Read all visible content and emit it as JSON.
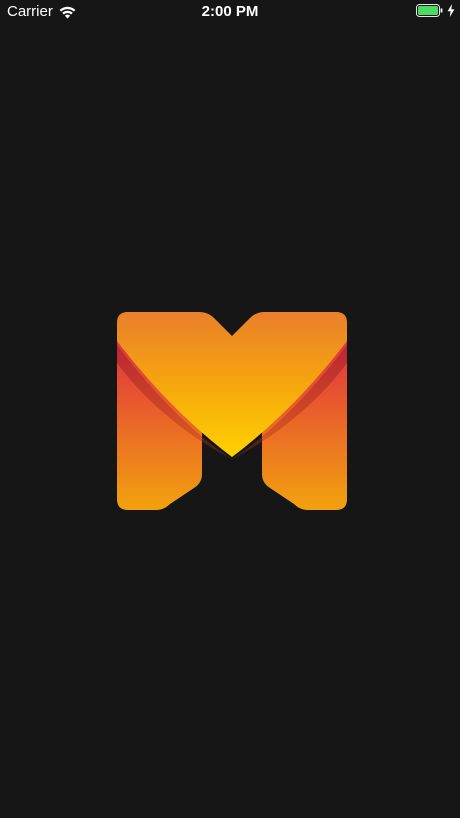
{
  "status_bar": {
    "carrier": "Carrier",
    "time": "2:00 PM",
    "battery_level": 1.0,
    "battery_color": "#4cd964",
    "charging": true
  },
  "splash": {
    "logo": "brand-m-logo",
    "background_color": "#161616",
    "logo_colors": [
      "#ffd200",
      "#f5a623",
      "#e8582e",
      "#d6244a"
    ]
  }
}
